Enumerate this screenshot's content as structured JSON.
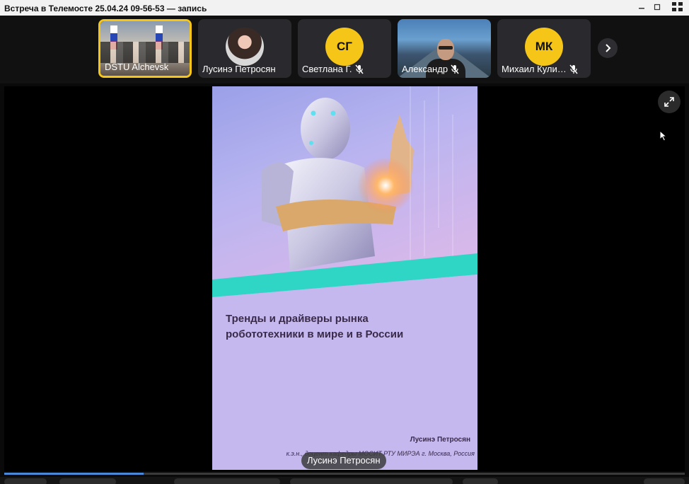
{
  "window": {
    "title": "Встреча в Телемосте 25.04.24 09-56-53 — запись"
  },
  "participants": [
    {
      "name": "DSTU Alchevsk",
      "type": "video",
      "active": true,
      "muted": false
    },
    {
      "name": "Лусинэ Петросян",
      "type": "photo",
      "active": false,
      "muted": false
    },
    {
      "name": "Светлана Г.",
      "initials": "СГ",
      "type": "initials",
      "active": false,
      "muted": true
    },
    {
      "name": "Александр",
      "type": "video",
      "active": false,
      "muted": true
    },
    {
      "name": "Михаил Кули…",
      "initials": "МК",
      "type": "initials",
      "active": false,
      "muted": true
    }
  ],
  "slide": {
    "heading_line1": "Тренды и драйверы рынка",
    "heading_line2": "робототехники в мире и в России",
    "author": "Лусинэ Петросян",
    "affiliation": "к.э.н., доцент кафедры МОСИТ РТУ МИРЭА  г. Москва, Россия"
  },
  "speaker_label": "Лусинэ Петросян",
  "playback": {
    "progress_fraction": 0.205
  },
  "colors": {
    "active_border": "#f5c518",
    "avatar_bg": "#f5c518",
    "progress": "#4a88d8",
    "slide_teal": "#2fd6c6"
  }
}
